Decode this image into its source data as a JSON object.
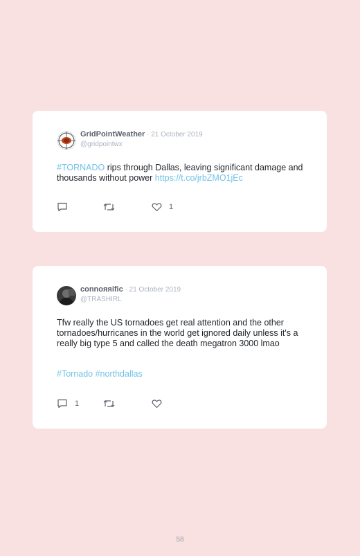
{
  "tweets": [
    {
      "author_name": "GridPointWeather",
      "separator": " · ",
      "date": "21 October 2019",
      "handle": "@gridpointwx",
      "body": {
        "hashtag": "#TORNADO",
        "text": " rips through Dallas, leaving significant damage and thousands without power ",
        "link": "https://t.co/jrbZMO1jEc"
      },
      "reply_count": "",
      "retweet_count": "",
      "like_count": "1"
    },
    {
      "author_name": "connoяяific",
      "separator": " · ",
      "date": "21 October 2019",
      "handle": "@TRASHIRL",
      "body": {
        "text": "Tfw really the US tornadoes get real attention and the other tornadoes/hurricanes in the world get ignored daily unless it's a really big type 5 and called the death megatron 3000 lmao",
        "hashtags": "#Tornado #northdallas"
      },
      "reply_count": "1",
      "retweet_count": "",
      "like_count": ""
    }
  ],
  "icons": {
    "reply": "reply-icon",
    "retweet": "retweet-icon",
    "like": "heart-icon"
  },
  "colors": {
    "background": "#f9e0e1",
    "card": "#ffffff",
    "link": "#71c2e6",
    "muted": "#aab3be",
    "icon": "#59606a"
  },
  "page_number": "58"
}
